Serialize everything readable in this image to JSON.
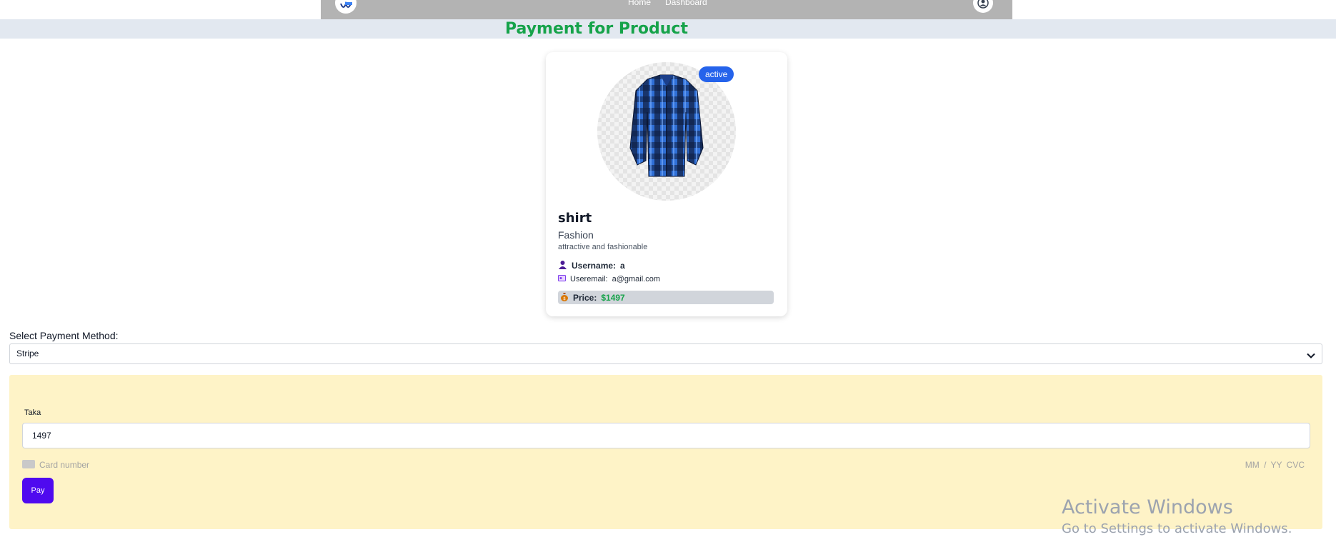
{
  "nav": {
    "links": [
      "Home",
      "Dashboard"
    ]
  },
  "page": {
    "title": "Payment for Product"
  },
  "product": {
    "status": "active",
    "name": "shirt",
    "category": "Fashion",
    "description": "attractive and fashionable",
    "username_label": "Username:",
    "username": "a",
    "email_label": "Useremail:",
    "email": "a@gmail.com",
    "price_label": "Price:",
    "price": "$1497"
  },
  "payment": {
    "method_label": "Select Payment Method:",
    "selected_method": "Stripe",
    "amount_label": "Taka",
    "amount_value": "1497",
    "card_placeholder": "Card number",
    "expiry_cvc_placeholder": "MM / YY  CVC",
    "pay_label": "Pay"
  },
  "watermark": {
    "line1": "Activate Windows",
    "line2": "Go to Settings to activate Windows."
  },
  "colors": {
    "title_green": "#16a34a",
    "badge_blue": "#2563eb",
    "pay_button": "#4f0aef",
    "payment_panel": "#fef3c7"
  }
}
